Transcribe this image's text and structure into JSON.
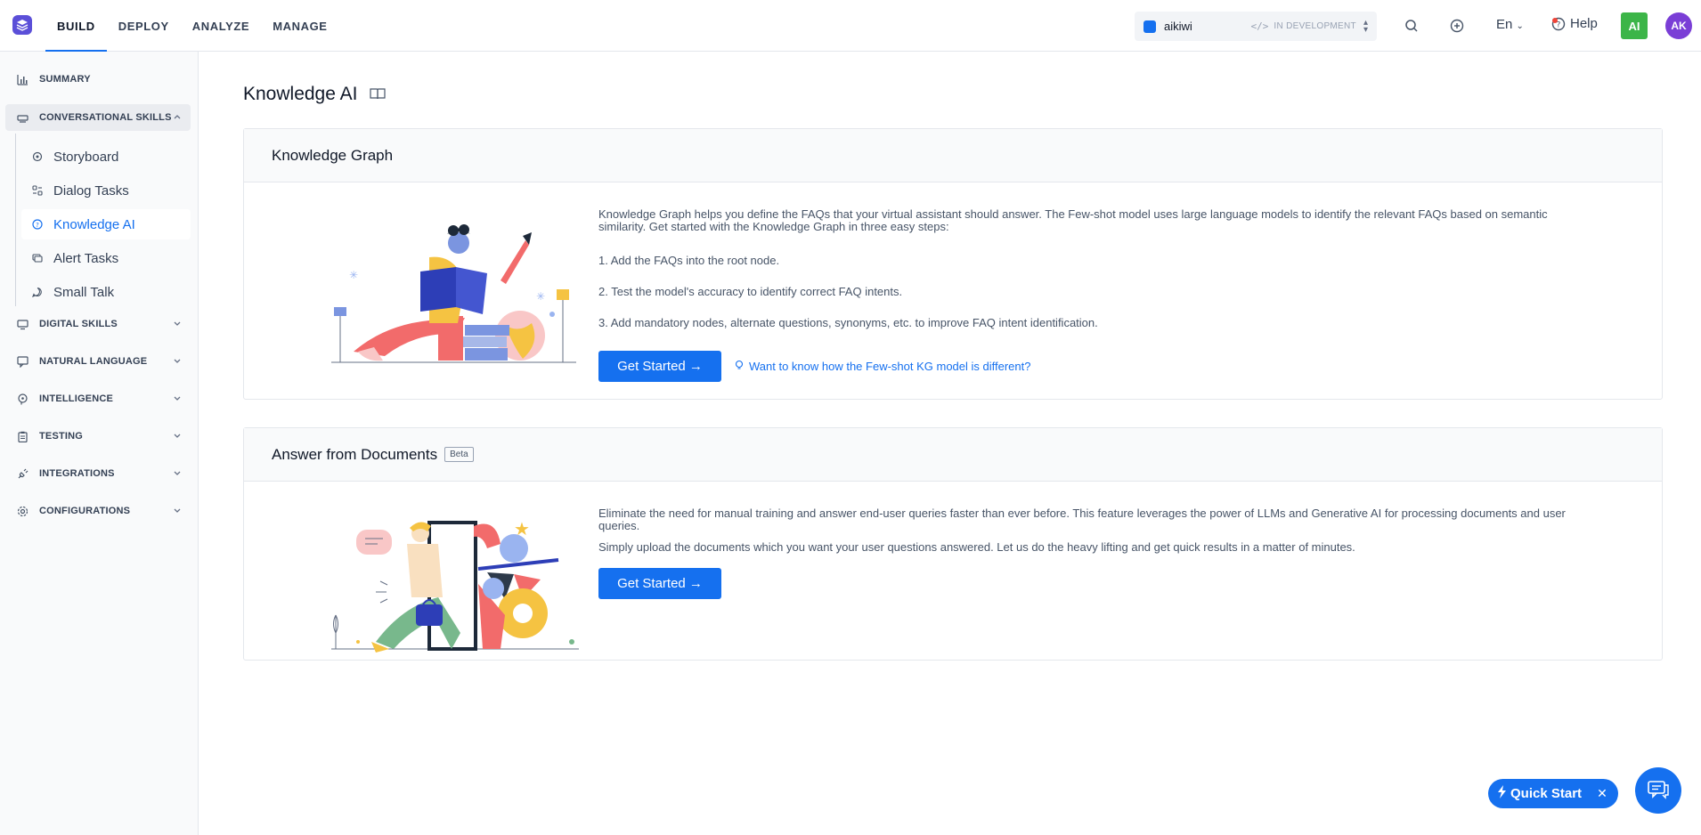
{
  "nav": {
    "items": [
      {
        "label": "BUILD",
        "active": true
      },
      {
        "label": "DEPLOY",
        "active": false
      },
      {
        "label": "ANALYZE",
        "active": false
      },
      {
        "label": "MANAGE",
        "active": false
      }
    ]
  },
  "app_switch": {
    "name": "aikiwi",
    "env": "IN DEVELOPMENT"
  },
  "header": {
    "lang": "En",
    "help": "Help",
    "ai_badge": "AI",
    "avatar": "AK"
  },
  "sidebar": {
    "summary": "SUMMARY",
    "conversational": "CONVERSATIONAL SKILLS",
    "sub_items": [
      {
        "label": "Storyboard"
      },
      {
        "label": "Dialog Tasks"
      },
      {
        "label": "Knowledge AI",
        "active": true
      },
      {
        "label": "Alert Tasks"
      },
      {
        "label": "Small Talk"
      }
    ],
    "groups": [
      {
        "label": "DIGITAL SKILLS"
      },
      {
        "label": "NATURAL LANGUAGE"
      },
      {
        "label": "INTELLIGENCE"
      },
      {
        "label": "TESTING"
      },
      {
        "label": "INTEGRATIONS"
      },
      {
        "label": "CONFIGURATIONS"
      }
    ]
  },
  "page": {
    "title": "Knowledge AI"
  },
  "kg_card": {
    "title": "Knowledge Graph",
    "intro": "Knowledge Graph helps you define the FAQs that your virtual assistant should answer. The Few-shot model uses large language models to identify the relevant FAQs based on semantic similarity. Get started with the Knowledge Graph in three easy steps:",
    "steps": [
      "1. Add the FAQs into the root node.",
      "2. Test the model's accuracy to identify correct FAQ intents.",
      "3. Add mandatory nodes, alternate questions, synonyms, etc. to improve FAQ intent identification."
    ],
    "button": "Get Started →",
    "link": "Want to know how the Few-shot KG model is different?"
  },
  "doc_card": {
    "title": "Answer from Documents",
    "badge": "Beta",
    "para1": "Eliminate the need for manual training and answer end-user queries faster than ever before. This feature leverages the power of LLMs and Generative AI for processing documents and user queries.",
    "para2": "Simply upload the documents which you want your user questions answered. Let us do the heavy lifting and get quick results in a matter of minutes.",
    "button": "Get Started →"
  },
  "quick_start": {
    "label": "Quick Start"
  },
  "icons": {
    "logo": "layers-logo-icon",
    "search": "search-icon",
    "add": "plus-circle-icon",
    "help": "help-circle-icon",
    "chat": "chat-icon"
  },
  "colors": {
    "accent": "#1570ef",
    "logo": "#5b4fd8",
    "ai_badge": "#3cb548",
    "avatar": "#7a3ed6"
  }
}
